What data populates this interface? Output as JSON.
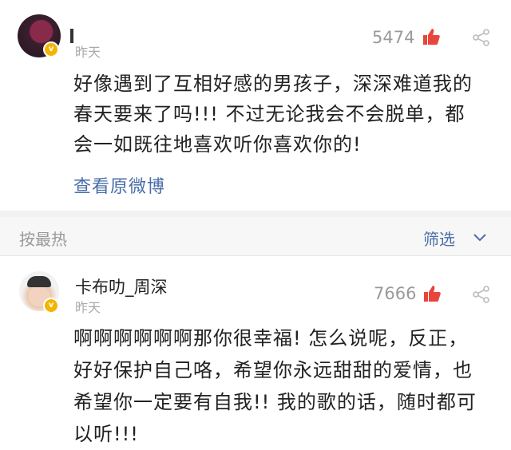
{
  "post": {
    "time": "昨天",
    "like_count": "5474",
    "lines": [
      "好像遇到了互相好感的男孩子，深深难道我的",
      "春天要来了吗!!! 不过无论我会不会脱单，都",
      "会一如既往地喜欢听你喜欢你的!"
    ],
    "view_original": "查看原微博"
  },
  "sort_bar": {
    "label": "按最热",
    "filter_label": "筛选"
  },
  "comment": {
    "username": "卡布叻_周深",
    "time": "昨天",
    "like_count": "7666",
    "lines": [
      "啊啊啊啊啊啊那你很幸福! 怎么说呢，反正，",
      "好好保护自己咯，希望你永远甜甜的爱情，也",
      "希望你一定要有自我!! 我的歌的话，随时都可",
      "以听!!!"
    ]
  },
  "colors": {
    "like_icon": "#e8453c",
    "link": "#4a6ea8",
    "badge": "#f5b400"
  },
  "icons": {
    "like": "thumbs-up-icon",
    "share": "share-icon",
    "chevron": "chevron-down-icon",
    "badge": "verified-badge-icon"
  }
}
